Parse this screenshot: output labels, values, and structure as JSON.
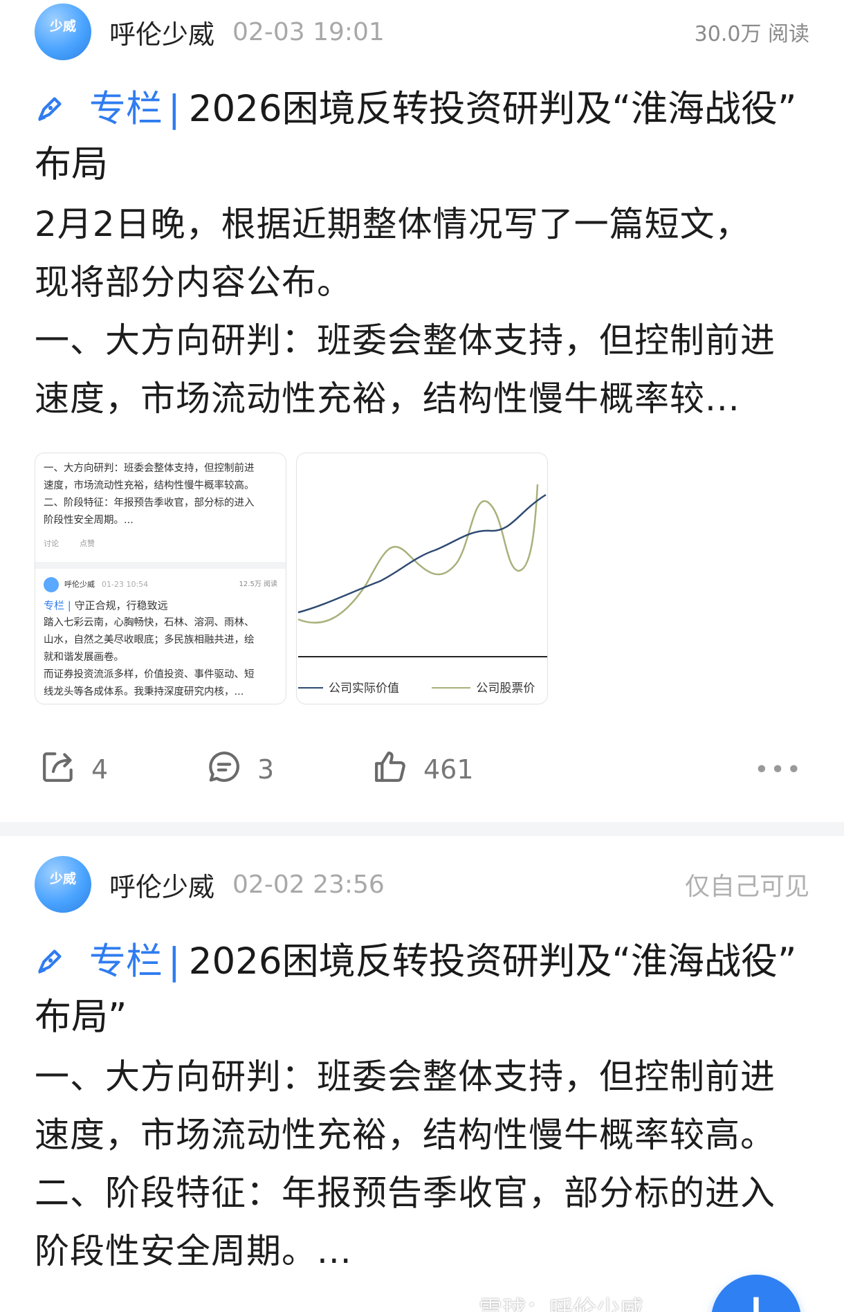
{
  "posts": [
    {
      "avatar_text": "少威",
      "author": "呼伦少威",
      "time": "02-03 19:01",
      "meta_right": "30.0万 阅读",
      "tag": "专栏",
      "title_text": "2026困境反转投资研判及“淮海战役”",
      "title_line2": "布局",
      "body_lines": [
        "2月2日晚，根据近期整体情况写了一篇短文，",
        "现将部分内容公布。",
        "一、大方向研判：班委会整体支持，但控制前进",
        "速度，市场流动性充裕，结构性慢牛概率较..."
      ],
      "thumb1": {
        "lines": [
          "一、大方向研判：班委会整体支持，但控制前进",
          "速度，市场流动性充裕，结构性慢牛概率较高。",
          "二、阶段特征：年报预告季收官，部分标的进入",
          "阶段性安全周期。..."
        ],
        "mini_discuss": "讨论",
        "mini_like": "点赞",
        "mini_author": "呼伦少威",
        "mini_time": "01-23 10:54",
        "mini_views": "12.5万 阅读",
        "mini_tag": "专栏",
        "mini_title": "守正合规，行稳致远",
        "mini_body": [
          "踏入七彩云南，心胸畅快，石林、溶洞、雨林、",
          "山水，自然之美尽收眼底；多民族相融共进，绘",
          "就和谐发展画卷。",
          "而证券投资流派多样，价值投资、事件驱动、短",
          "线龙头等各成体系。我秉持深度研究内核，..."
        ]
      },
      "thumb2": {
        "legend": [
          "公司实际价值",
          "公司股票价"
        ],
        "colors": {
          "value": "#2e4a72",
          "price": "#a9b07a"
        }
      },
      "share_count": "4",
      "comment_count": "3",
      "like_count": "461"
    },
    {
      "avatar_text": "少威",
      "author": "呼伦少威",
      "time": "02-02 23:56",
      "meta_right": "仅自己可见",
      "tag": "专栏",
      "title_text": "2026困境反转投资研判及“淮海战役”",
      "title_line2": "布局”",
      "body_lines": [
        "一、大方向研判：班委会整体支持，但控制前进",
        "速度，市场流动性充裕，结构性慢牛概率较高。",
        "二、阶段特征：年报预告季收官，部分标的进入",
        "阶段性安全周期。..."
      ]
    }
  ],
  "watermark": "雪球：呼伦少威",
  "fab_symbol": "+",
  "accent_color": "#2f7cf0"
}
